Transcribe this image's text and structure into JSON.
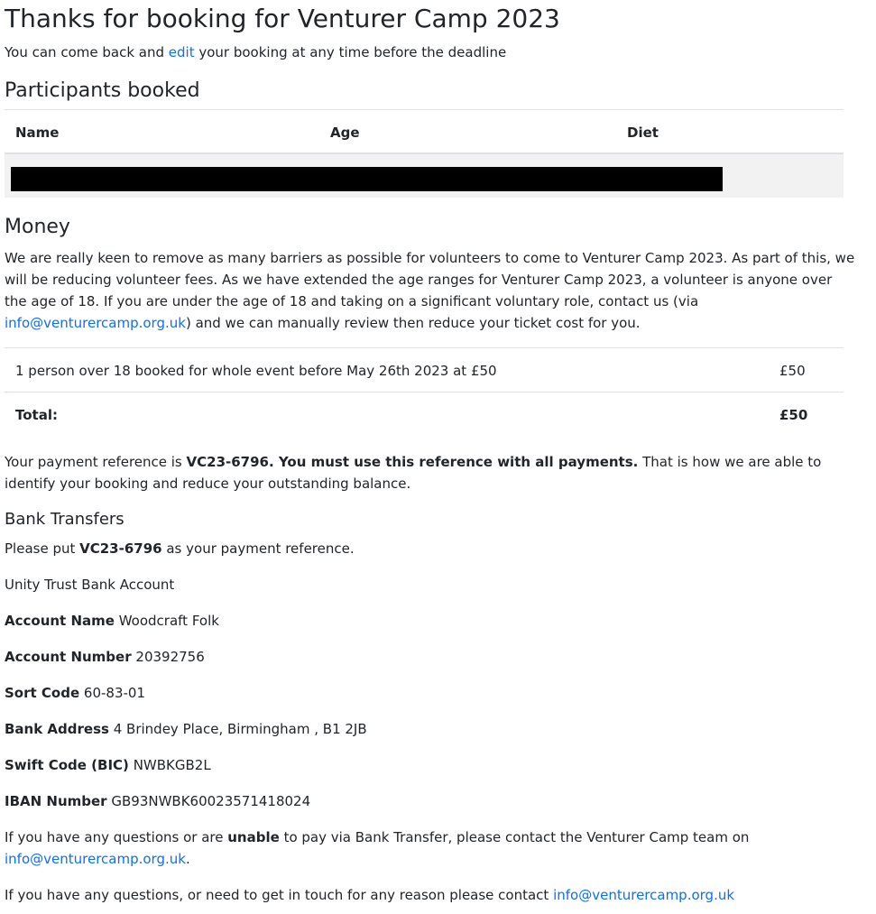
{
  "header": {
    "title": "Thanks for booking for Venturer Camp 2023",
    "subtitle_before": "You can come back and ",
    "edit_link": "edit",
    "subtitle_after": " your booking at any time before the deadline"
  },
  "participants": {
    "heading": "Participants booked",
    "columns": [
      "Name",
      "Age",
      "Diet"
    ]
  },
  "money": {
    "heading": "Money",
    "para_before": "We are really keen to remove as many barriers as possible for volunteers to come to Venturer Camp 2023. As part of this, we will be reducing volunteer fees. As we have extended the age ranges for Venturer Camp 2023, a volunteer is anyone over the age of 18. If you are under the age of 18 and taking on a significant voluntary role, contact us (via ",
    "email": "info@venturercamp.org.uk",
    "para_after": ") and we can manually review then reduce your ticket cost for you.",
    "line_item": {
      "description": "1 person over 18 booked for whole event before May 26th 2023 at £50",
      "amount": "£50"
    },
    "total_label": "Total:",
    "total_amount": "£50"
  },
  "payment": {
    "text1": "Your payment reference is ",
    "reference": "VC23-6796",
    "text2": ". ",
    "must_use": "You must use this reference with all payments.",
    "text3": " That is how we are able to identify your booking and reduce your outstanding balance."
  },
  "bank": {
    "heading": "Bank Transfers",
    "put_before": "Please put ",
    "put_after": " as your payment reference.",
    "account_type": "Unity Trust Bank Account",
    "account_name_label": "Account Name",
    "account_name": "Woodcraft Folk",
    "account_number_label": "Account Number",
    "account_number": "20392756",
    "sort_code_label": "Sort Code",
    "sort_code": "60-83-01",
    "bank_address_label": "Bank Address",
    "bank_address": "4 Brindey Place, Birmingham , B1 2JB",
    "swift_label": "Swift Code (BIC)",
    "swift": "NWBKGB2L",
    "iban_label": "IBAN Number",
    "iban": "GB93NWBK60023571418024"
  },
  "contact": {
    "q_before": "If you have any questions or are ",
    "unable": "unable",
    "q_after": " to pay via Bank Transfer, please contact the Venturer Camp team on",
    "q_email": "info@venturercamp.org.uk",
    "q_end": ".",
    "general": "If you have any questions, or need to get in touch for any reason please contact ",
    "general_email": "info@venturercamp.org.uk"
  }
}
